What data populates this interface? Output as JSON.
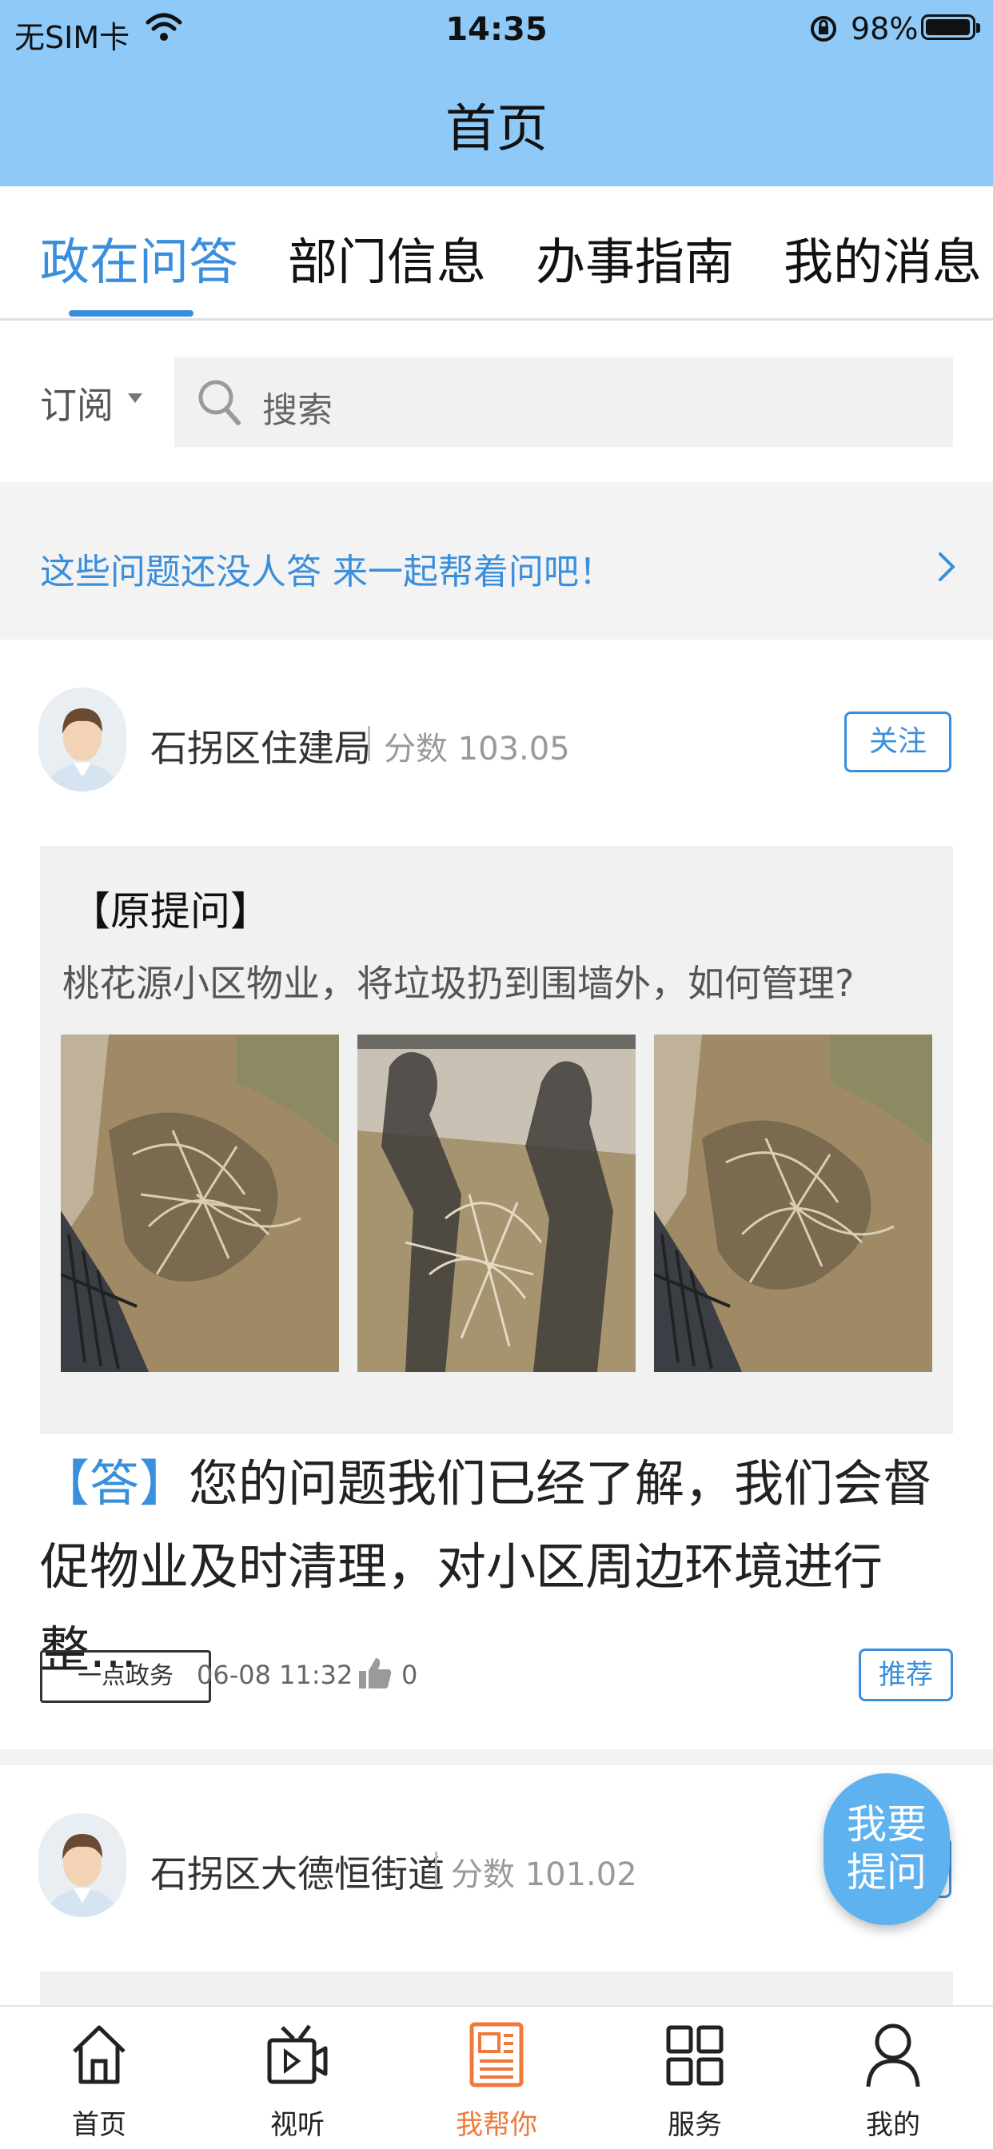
{
  "status_bar": {
    "carrier": "无SIM卡",
    "time": "14:35",
    "battery": "98%",
    "battery_level": 0.98
  },
  "header": {
    "title": "首页"
  },
  "tabs": [
    {
      "label": "政在问答",
      "active": true
    },
    {
      "label": "部门信息",
      "active": false
    },
    {
      "label": "办事指南",
      "active": false
    },
    {
      "label": "我的消息",
      "active": false
    }
  ],
  "filter": {
    "subscribe_label": "订阅",
    "search_placeholder": "搜索"
  },
  "notice": {
    "text": "这些问题还没人答 来一起帮着问吧！"
  },
  "posts": [
    {
      "author": "石拐区住建局",
      "score": "分数 103.05",
      "follow_label": "关注",
      "question_label": "【原提问】",
      "question": "桃花源小区物业，将垃圾扔到围墙外，如何管理?",
      "answer_tag": "【答】",
      "answer": "您的问题我们已经了解，我们会督促物业及时清理，对小区周边环境进行整...",
      "source_tag": "一点政务",
      "time": "06-08 11:32",
      "likes": "0",
      "recommend_label": "推荐"
    },
    {
      "author": "石拐区大德恒街道",
      "score": "分数 101.02"
    }
  ],
  "fab": {
    "line1": "我要",
    "line2": "提问"
  },
  "bottom_nav": [
    {
      "label": "首页",
      "icon": "home-icon",
      "active": false
    },
    {
      "label": "视听",
      "icon": "tv-icon",
      "active": false
    },
    {
      "label": "我帮你",
      "icon": "document-icon",
      "active": true
    },
    {
      "label": "服务",
      "icon": "grid-icon",
      "active": false
    },
    {
      "label": "我的",
      "icon": "person-icon",
      "active": false
    }
  ],
  "colors": {
    "header_bg": "#8ec9f7",
    "accent": "#3a8fdc",
    "active_nav": "#f0793a"
  }
}
